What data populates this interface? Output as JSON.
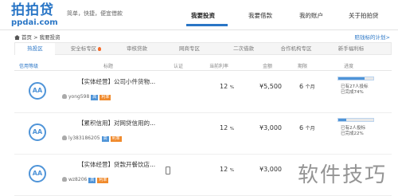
{
  "logo": {
    "main": "拍拍贷",
    "sub": "ppdai.com"
  },
  "slogan": "简单，快捷，便宜借款",
  "nav": [
    "我要投资",
    "我要借款",
    "我的账户",
    "关于拍拍贷"
  ],
  "breadcrumb": {
    "home": "首页",
    "sep": " > ",
    "current": "我要投资"
  },
  "breadcrumb_right": "赔钱标的计划>",
  "tabs": [
    "热投区",
    "安全标专区",
    "审核贷款",
    "网商专区",
    "二次借款",
    "合作机构专区",
    "新手福利标"
  ],
  "columns": [
    "信用等级",
    "标题",
    "认证",
    "当前利率",
    "金额",
    "期限",
    "进度"
  ],
  "loans": [
    {
      "grade": "AA",
      "title": "【实体经营】公司小件货物...",
      "user": "yong598",
      "badges": [
        "高",
        "利率"
      ],
      "rate": "12",
      "rate_unit": "%",
      "amount": "¥5,500",
      "term": "6",
      "term_unit": "个月",
      "progress": 0.74,
      "stat1": "已有27人投标",
      "stat2": "已完成74%"
    },
    {
      "grade": "AA",
      "title": "【累积信用】对网贷信用的...",
      "user": "ly383186205",
      "badges": [
        "高",
        "利率"
      ],
      "rate": "12",
      "rate_unit": "%",
      "amount": "¥3,000",
      "term": "6",
      "term_unit": "个月",
      "progress": 0.22,
      "stat1": "已有2人投标",
      "stat2": "已完成22%"
    },
    {
      "grade": "AA",
      "title": "【实体经营】贷款开餐饮店...",
      "user": "wz8206",
      "badges": [
        "高",
        "利率"
      ],
      "rate": "12",
      "rate_unit": "%",
      "amount": "¥3,000",
      "term": "6",
      "term_unit": "个月",
      "progress": 0.0,
      "stat1": "",
      "stat2": ""
    }
  ],
  "watermark": "软件技巧",
  "colors": {
    "brand": "#2a76c6",
    "badge_blue": "#4f94d8",
    "badge_orange": "#f08a2c"
  }
}
